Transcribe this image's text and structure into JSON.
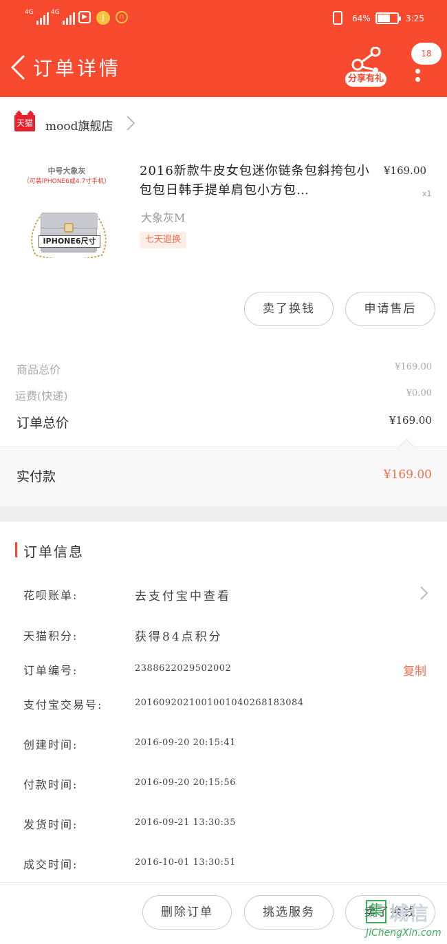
{
  "status_bar": {
    "signal1_label": "4G",
    "signal2_label": "4G",
    "battery_percent": "64%",
    "time": "3:25"
  },
  "nav": {
    "title": "订单详情",
    "share_label": "分享有礼",
    "message_count": "18"
  },
  "shop": {
    "badge": "天猫",
    "name": "mood旗舰店"
  },
  "product": {
    "image_caption_line1": "中号大象灰",
    "image_caption_line2": "（可装IPHONE6或4.7寸手机）",
    "image_box_label": "IPHONE6尺寸",
    "title": "2016新款牛皮女包迷你链条包斜挎包小包包日韩手提单肩包小方包…",
    "price": "¥169.00",
    "quantity": "x1",
    "sku": "大象灰M",
    "tag": "七天退换"
  },
  "product_actions": {
    "resell": "卖了换钱",
    "after_sale": "申请售后"
  },
  "summary": {
    "goods_total_label": "商品总价",
    "goods_total_value": "¥169.00",
    "shipping_label": "运费(快递)",
    "shipping_value": "¥0.00",
    "order_total_label": "订单总价",
    "order_total_value": "¥169.00",
    "paid_label": "实付款",
    "paid_value": "¥169.00"
  },
  "order_info": {
    "heading": "订单信息",
    "huabei_label": "花呗账单:",
    "huabei_value": "去支付宝中查看",
    "points_label": "天猫积分:",
    "points_value": "获得84点积分",
    "order_no_label": "订单编号:",
    "order_no_value": "2388622029502002",
    "copy_label": "复制",
    "alipay_no_label": "支付宝交易号:",
    "alipay_no_value": "2016092021001001040268183084",
    "created_label": "创建时间:",
    "created_value": "2016-09-20 20:15:41",
    "paid_time_label": "付款时间:",
    "paid_time_value": "2016-09-20 20:15:56",
    "shipped_label": "发货时间:",
    "shipped_value": "2016-09-21 13:30:35",
    "completed_label": "成交时间:",
    "completed_value": "2016-10-01 13:30:51"
  },
  "bottom_actions": {
    "delete": "删除订单",
    "services": "挑选服务",
    "resell": "卖了换钱"
  },
  "watermark": {
    "brand": "城信",
    "url": "JiChengXin.com"
  }
}
